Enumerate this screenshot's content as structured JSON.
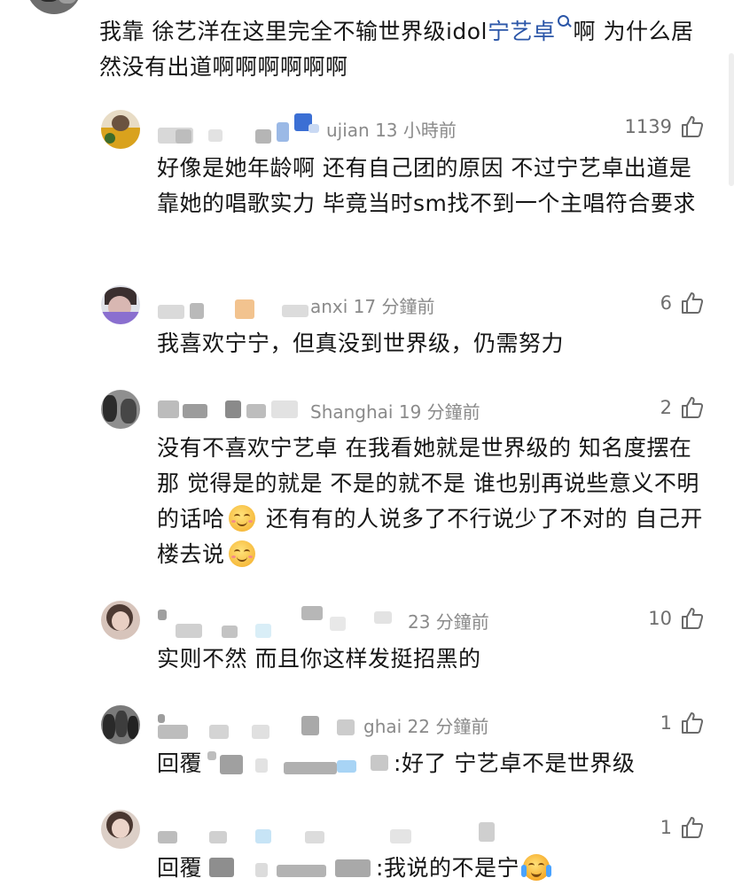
{
  "main_comment": {
    "text_before_topic": "我靠 徐艺洋在这里完全不输世界级idol",
    "topic": "宁艺卓",
    "text_after_topic": "啊 为什么居然没有出道啊啊啊啊啊啊"
  },
  "replies": [
    {
      "meta": "ujian 13 小時前",
      "likes": "1139",
      "text": "好像是她年龄啊 还有自己团的原因 不过宁艺卓出道是靠她的唱歌实力 毕竟当时sm找不到一个主唱符合要求"
    },
    {
      "meta": "anxi 17 分鐘前",
      "likes": "6",
      "text": "我喜欢宁宁，但真没到世界级，仍需努力"
    },
    {
      "meta": "Shanghai 19 分鐘前",
      "likes": "2",
      "text_part1": "没有不喜欢宁艺卓 在我看她就是世界级的 知名度摆在那 觉得是的就是 不是的就不是 谁也别再说些意义不明的话哈",
      "text_part2": " 还有有的人说多了不行说少了不对的 自己开楼去说"
    },
    {
      "meta": "23 分鐘前",
      "likes": "10",
      "text": "实则不然 而且你这样发挺招黑的"
    },
    {
      "meta": "ghai 22 分鐘前",
      "likes": "1",
      "reply_prefix": "回覆",
      "text": ":好了 宁艺卓不是世界级"
    },
    {
      "meta": "",
      "likes": "1",
      "reply_prefix": "回覆",
      "text": ":我说的不是宁"
    }
  ],
  "icons": {
    "like": "thumbs-up-icon",
    "topic_search": "search-icon",
    "smile": "smiling-face-emoji",
    "cry": "crying-laughing-emoji"
  },
  "colors": {
    "topic_link": "#2b56a8",
    "meta_text": "#8a8a8a",
    "body_text": "#161616"
  }
}
